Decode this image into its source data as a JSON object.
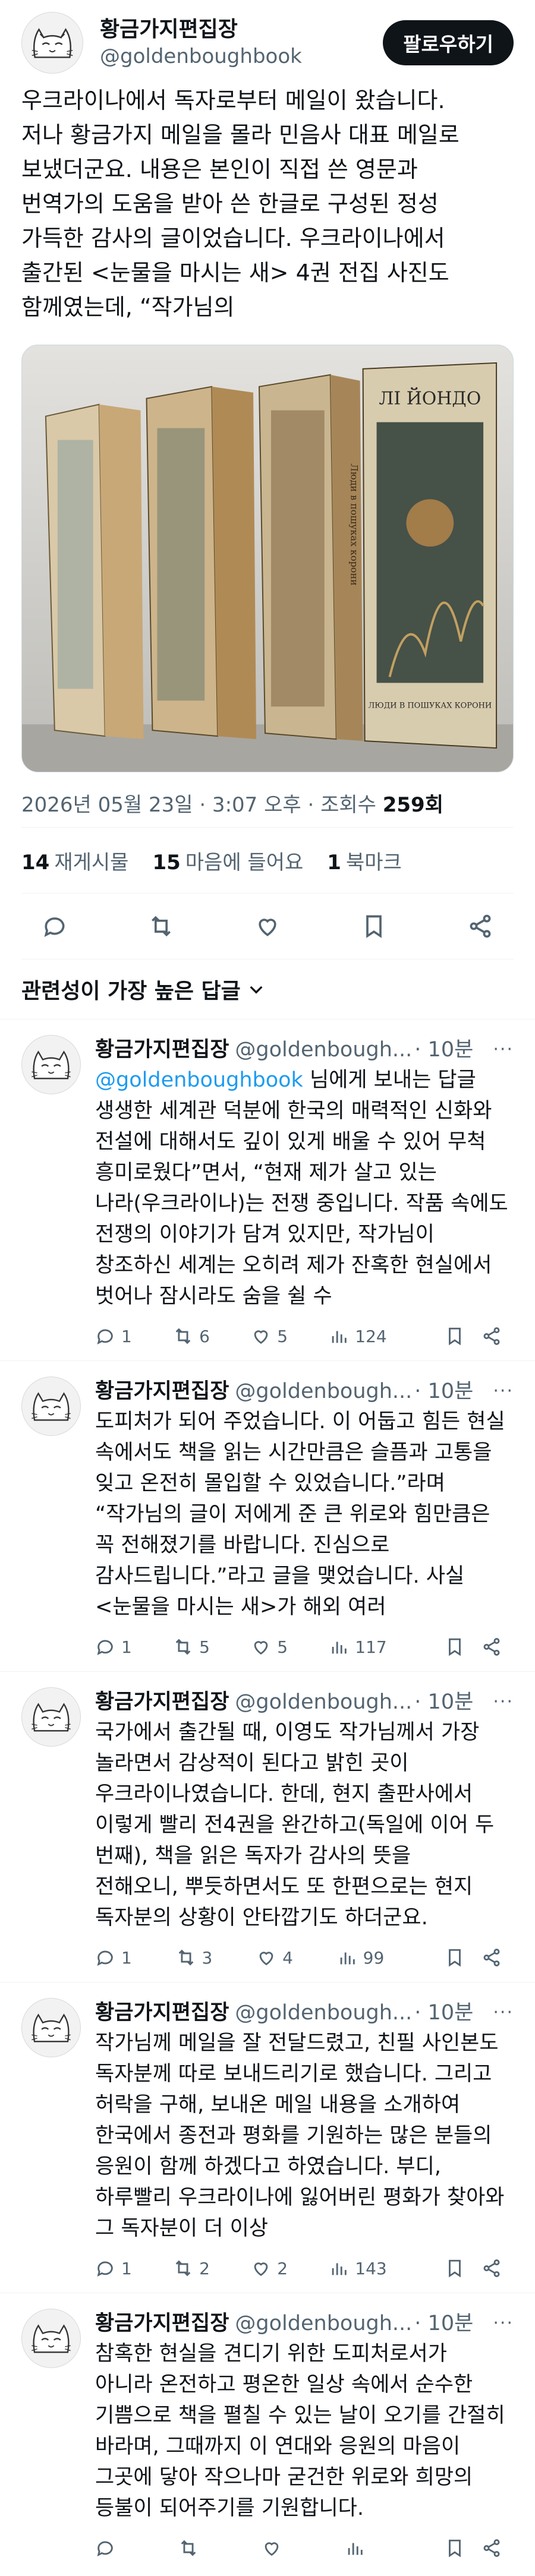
{
  "post": {
    "author_name": "황금가지편집장",
    "author_handle": "@goldenboughbook",
    "follow_label": "팔로우하기",
    "text": "우크라이나에서 독자로부터 메일이 왔습니다.\n저나 황금가지 메일을 몰라 민음사 대표 메일로\n보냈더군요. 내용은 본인이 직접 쓴 영문과\n번역가의 도움을 받아 쓴 한글로 구성된 정성\n가득한 감사의 글이었습니다. 우크라이나에서\n출간된 <눈물을 마시는 새> 4권 전집 사진도\n함께였는데, “작가님의",
    "media_alt": "Книги",
    "book_title": "ЛІ ЙОНДО",
    "book_spine": "Люди в пошуках корони",
    "book_cover_sub": "ЛЮДИ В ПОШУКАХ КОРОНИ",
    "date": "2026년 05월 23일 · 3:07 오후 · 조회수 ",
    "views": "259회",
    "stats": [
      {
        "count": "14",
        "label": "재게시물"
      },
      {
        "count": "15",
        "label": "마음에 들어요"
      },
      {
        "count": "1",
        "label": "북마크"
      }
    ],
    "sort_label": "관련성이 가장 높은 답글"
  },
  "replies": [
    {
      "name": "황금가지편집장",
      "handle": "@goldenbough...",
      "time": "· 10분",
      "mention": "@goldenboughbook",
      "mention_suffix": " 님에게 보내는 답글",
      "text": "생생한 세계관 덕분에 한국의 매력적인 신화와\n전설에 대해서도 깊이 있게 배울 수 있어 무척\n흥미로웠다”면서, “현재 제가 살고 있는\n나라(우크라이나)는 전쟁 중입니다. 작품 속에도\n전쟁의 이야기가 담겨 있지만, 작가님이\n창조하신 세계는 오히려 제가 잔혹한 현실에서\n벗어나 잠시라도 숨을 쉴 수",
      "replies": "1",
      "retweets": "6",
      "likes": "5",
      "views": "124"
    },
    {
      "name": "황금가지편집장",
      "handle": "@goldenbough...",
      "time": "· 10분",
      "mention": "",
      "mention_suffix": "",
      "text": "도피처가 되어 주었습니다. 이 어둡고 힘든 현실\n속에서도 책을 읽는 시간만큼은 슬픔과 고통을\n잊고 온전히 몰입할 수 있었습니다.”라며\n“작가님의 글이 저에게 준 큰 위로와 힘만큼은\n꼭 전해졌기를 바랍니다. 진심으로\n감사드립니다.”라고 글을 맺었습니다. 사실\n<눈물을 마시는 새>가 해외 여러",
      "replies": "1",
      "retweets": "5",
      "likes": "5",
      "views": "117"
    },
    {
      "name": "황금가지편집장",
      "handle": "@goldenbough...",
      "time": "· 10분",
      "mention": "",
      "mention_suffix": "",
      "text": "국가에서 출간될 때, 이영도 작가님께서 가장\n놀라면서 감상적이 된다고 밝힌 곳이\n우크라이나였습니다. 한데, 현지 출판사에서\n이렇게 빨리 전4권을 완간하고(독일에 이어 두\n번째), 책을 읽은 독자가 감사의 뜻을\n전해오니, 뿌듯하면서도 또 한편으로는 현지\n독자분의 상황이 안타깝기도 하더군요.",
      "replies": "1",
      "retweets": "3",
      "likes": "4",
      "views": "99"
    },
    {
      "name": "황금가지편집장",
      "handle": "@goldenbough...",
      "time": "· 10분",
      "mention": "",
      "mention_suffix": "",
      "text": "작가님께 메일을 잘 전달드렸고, 친필 사인본도\n독자분께 따로 보내드리기로 했습니다. 그리고\n허락을 구해, 보내온 메일 내용을 소개하여\n한국에서 종전과 평화를 기원하는 많은 분들의\n응원이 함께 하겠다고 하였습니다. 부디,\n하루빨리 우크라이나에 잃어버린 평화가 찾아와\n그 독자분이 더 이상",
      "replies": "1",
      "retweets": "2",
      "likes": "2",
      "views": "143"
    },
    {
      "name": "황금가지편집장",
      "handle": "@goldenbough...",
      "time": "· 10분",
      "mention": "",
      "mention_suffix": "",
      "text": "참혹한 현실을 견디기 위한 도피처로서가\n아니라 온전하고 평온한 일상 속에서 순수한\n기쁨으로 책을 펼칠 수 있는 날이 오기를 간절히\n바라며, 그때까지 이 연대와 응원의 마음이\n그곳에 닿아 작으나마 굳건한 위로와 희망의\n등불이 되어주기를 기원합니다.",
      "replies": "",
      "retweets": "",
      "likes": "",
      "views": ""
    }
  ]
}
